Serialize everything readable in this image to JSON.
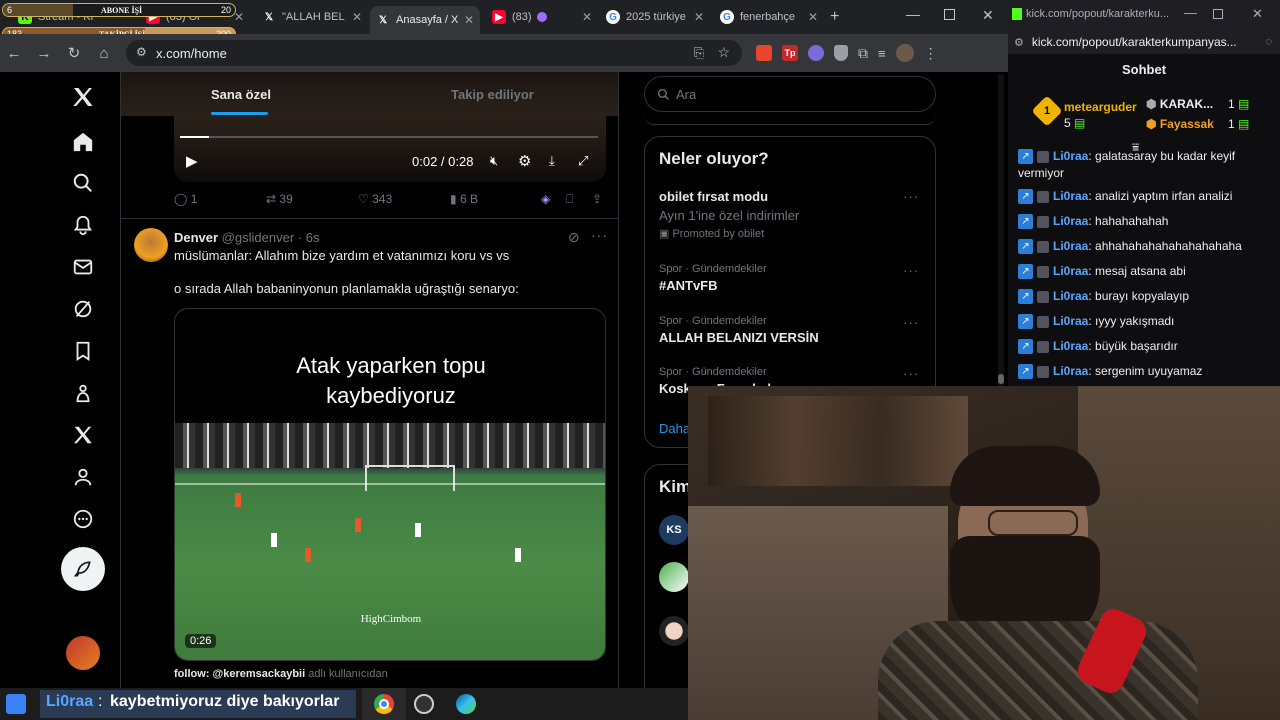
{
  "overlay": {
    "abone_label": "ABONE İŞİ",
    "abone_current": "6",
    "abone_goal": "20",
    "takipci_label": "TAKİPÇİ İŞİ",
    "takipci_current": "183",
    "takipci_goal": "300"
  },
  "browser": {
    "tabs": [
      {
        "label": "Stream - Ki",
        "icon": "kick-icon",
        "color": "#53fc18"
      },
      {
        "label": "(83) Ol",
        "icon": "youtube-icon",
        "color": "#ff0033"
      },
      {
        "label": "\"ALLAH BEL",
        "icon": "x-logo-icon",
        "color": "#ffffff"
      },
      {
        "label": "Anasayfa / X",
        "icon": "x-logo-icon",
        "color": "#ffffff"
      },
      {
        "label": "(83)",
        "icon": "youtube-icon",
        "color": "#ff0033"
      },
      {
        "label": "2025 türkiye",
        "icon": "google-icon",
        "color": "#4285f4"
      },
      {
        "label": "fenerbahçe",
        "icon": "google-icon",
        "color": "#4285f4"
      }
    ],
    "url": "x.com/home"
  },
  "x": {
    "tabs": {
      "for_you": "Sana özel",
      "following": "Takip ediliyor"
    },
    "video_time": "0:02 / 0:28",
    "top_post_stats": {
      "replies": "1",
      "reposts": "39",
      "likes": "343",
      "views": "6 B"
    },
    "post": {
      "name": "Denver",
      "handle": "@gslidenver",
      "time": "· 6s",
      "line1": "müslümanlar: Allahım bize yardım et vatanımızı koru vs vs",
      "line2": "o sırada Allah babaninyonun planlamakla uğraştığı senaryo:",
      "video_caption_1": "Atak yaparken topu",
      "video_caption_2": "kaybediyoruz",
      "video_watermark": "HighCimbom",
      "video_duration": "0:26",
      "follow_text": "follow: @keremsackaybii",
      "follow_suffix": "adlı kullanıcıdan"
    },
    "search_placeholder": "Ara",
    "trends_title": "Neler oluyor?",
    "promo": {
      "title": "obilet fırsat modu",
      "desc": "Ayın 1'ine özel indirimler",
      "promoted": "Promoted by obilet"
    },
    "trends": [
      {
        "meta": "Spor · Gündemdekiler",
        "title": "#ANTvFB"
      },
      {
        "meta": "Spor · Gündemdekiler",
        "title": "ALLAH BELANIZI VERSİN"
      },
      {
        "meta": "Spor · Gündemdekiler",
        "title": "Koskoca Fenerbahçe"
      }
    ],
    "show_more": "Daha",
    "who_to_follow": "Kim"
  },
  "kick": {
    "url": "kick.com/popout/karakterkumpanyas...",
    "window_title": "kick.com/popout/karakterku...",
    "chat_title": "Sohbet",
    "leaderboard": [
      {
        "name": "metearguder",
        "count": "5",
        "rank": "1"
      },
      {
        "name": "KARAK...",
        "count": "1"
      },
      {
        "name": "Fayassak",
        "count": "1"
      }
    ],
    "messages": [
      {
        "user": "Li0raa",
        "text": "galatasaray bu kadar keyif vermiyor"
      },
      {
        "user": "Li0raa",
        "text": "analizi yaptım irfan analizi"
      },
      {
        "user": "Li0raa",
        "text": "hahahahahah"
      },
      {
        "user": "Li0raa",
        "text": "ahhahahahahahahahahaha"
      },
      {
        "user": "Li0raa",
        "text": "mesaj atsana abi"
      },
      {
        "user": "Li0raa",
        "text": "burayı kopyalayıp"
      },
      {
        "user": "Li0raa",
        "text": "ıyyy yakışmadı"
      },
      {
        "user": "Li0raa",
        "text": "büyük başarıdır"
      },
      {
        "user": "Li0raa",
        "text": "sergenim uyuyamaz"
      }
    ]
  },
  "ticker": {
    "user": "Li0raa",
    "sep": " : ",
    "text": "kaybetmiyoruz diye bakıyorlar"
  }
}
